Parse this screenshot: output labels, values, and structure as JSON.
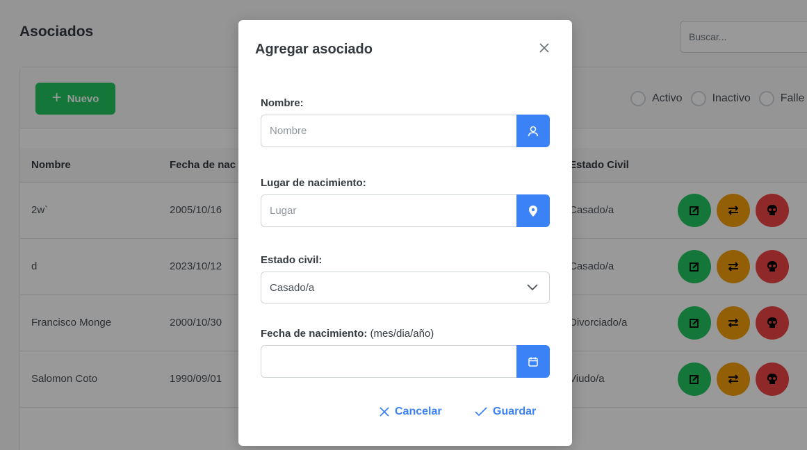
{
  "page": {
    "title": "Asociados",
    "search_placeholder": "Buscar...",
    "new_button_label": "Nuevo",
    "status_filters": [
      "Activo",
      "Inactivo",
      "Falle"
    ]
  },
  "table": {
    "headers": {
      "nombre": "Nombre",
      "fecha": "Fecha de nac",
      "estado_civil": "Estado Civil"
    },
    "rows": [
      {
        "nombre": "2w`",
        "fecha": "2005/10/16",
        "estado_civil": "Casado/a"
      },
      {
        "nombre": "d",
        "fecha": "2023/10/12",
        "estado_civil": "Casado/a"
      },
      {
        "nombre": "Francisco Monge",
        "fecha": "2000/10/30",
        "estado_civil": "Divorciado/a"
      },
      {
        "nombre": "Salomon Coto",
        "fecha": "1990/09/01",
        "estado_civil": "Viudo/a"
      }
    ]
  },
  "modal": {
    "title": "Agregar asociado",
    "nombre_label": "Nombre:",
    "nombre_placeholder": "Nombre",
    "lugar_label": "Lugar de nacimiento:",
    "lugar_placeholder": "Lugar",
    "estado_label": "Estado civil:",
    "estado_value": "Casado/a",
    "fecha_label": "Fecha de nacimiento:",
    "fecha_hint": "(mes/dia/año)",
    "fecha_value": "",
    "cancel_label": "Cancelar",
    "save_label": "Guardar"
  },
  "colors": {
    "primary": "#3b82f6",
    "success": "#22c55e",
    "warning": "#f59e0b",
    "danger": "#ef4444"
  },
  "icons": [
    "plus-icon",
    "close-icon",
    "user-icon",
    "map-marker-icon",
    "chevron-down-icon",
    "calendar-icon",
    "times-icon",
    "check-icon",
    "edit-icon",
    "swap-icon",
    "skull-icon"
  ]
}
